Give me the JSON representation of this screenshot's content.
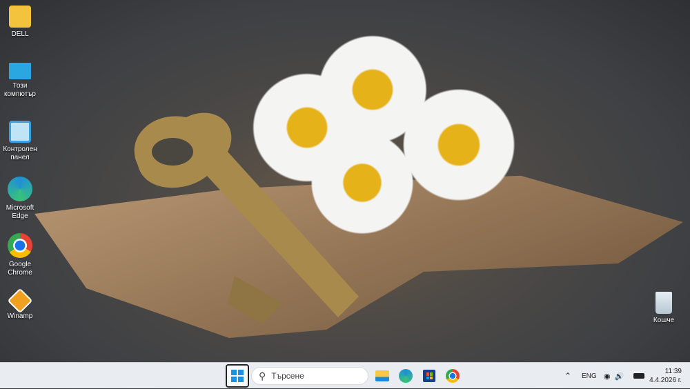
{
  "desktop": {
    "icons": [
      {
        "label": "DELL",
        "icon": "folder-user-icon",
        "color": "#f3c33e"
      },
      {
        "label": "Този компютър",
        "icon": "monitor-icon",
        "color": "#2aa6e0"
      },
      {
        "label": "Контролен панел",
        "icon": "control-panel-icon",
        "color": "#3da0e0"
      },
      {
        "label": "Microsoft Edge",
        "icon": "edge-icon",
        "color": "#1f8fd8"
      },
      {
        "label": "Google Chrome",
        "icon": "chrome-icon",
        "color": "#e94235"
      },
      {
        "label": "Winamp",
        "icon": "winamp-icon",
        "color": "#f0a020"
      }
    ],
    "recycle_bin": {
      "label": "Кошче",
      "icon": "recycle-bin-icon"
    }
  },
  "taskbar": {
    "search_placeholder": "Търсене",
    "apps": [
      "start-icon",
      "file-explorer-icon",
      "edge-icon",
      "store-icon",
      "chrome-icon"
    ],
    "tray": {
      "language": "ENG",
      "time": "11:39",
      "date": "4.4.2026 г."
    }
  }
}
